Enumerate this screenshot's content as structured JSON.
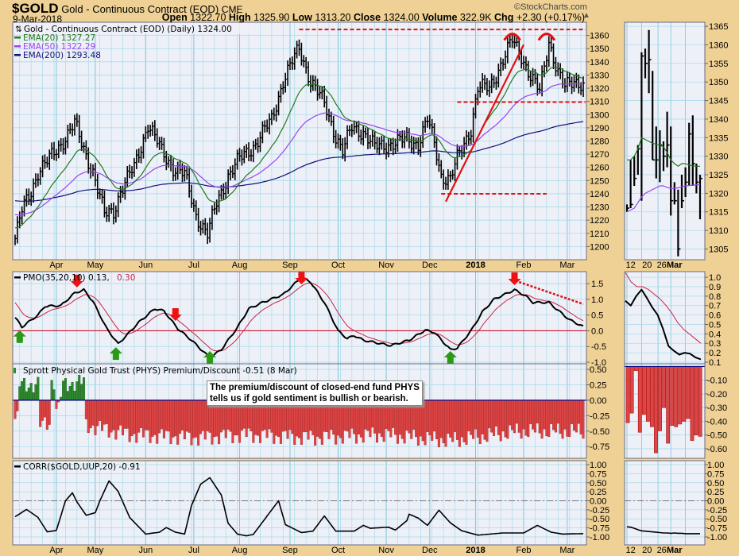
{
  "header": {
    "symbol": "$GOLD",
    "name": "Gold - Continuous Contract (EOD)",
    "exchange": "CME",
    "date": "9-Mar-2018",
    "copyright": "©StockCharts.com",
    "open_label": "Open",
    "open": "1322.70",
    "high_label": "High",
    "high": "1325.90",
    "low_label": "Low",
    "low": "1313.20",
    "close_label": "Close",
    "close": "1324.00",
    "volume_label": "Volume",
    "volume": "322.9K",
    "chg_label": "Chg",
    "chg": "+2.30 (+0.17%)"
  },
  "legend": {
    "price": "Gold - Continuous Contract (EOD) (Daily) 1324.00",
    "ema20": "EMA(20) 1327.27",
    "ema50": "EMA(50) 1322.29",
    "ema200": "EMA(200) 1293.48",
    "pmo_a": "PMO(35,20,10) 0.13,",
    "pmo_b": "0.30",
    "phys": "Sprott Physical Gold Trust (PHYS) Premium/Discount -0.51 (8 Mar)",
    "corr": "CORR($GOLD,UUP,20) -0.91"
  },
  "annotation_note": {
    "line1": "The premium/discount of closed-end fund PHYS",
    "line2": "tells us if gold sentiment is bullish or bearish."
  },
  "colors": {
    "ema20": "#1f7a1f",
    "ema50": "#9a44ee",
    "ema200": "#10107a",
    "pmo": "#000000",
    "signal": "#cc2244",
    "annotation": "#e01010",
    "phys_pos": "#2e8b2e",
    "phys_neg": "#dd4444",
    "grid": "#a9dbe9",
    "grid_major": "#7cc6dc"
  },
  "chart_data": {
    "type": "line",
    "title": "$GOLD Gold - Continuous Contract (EOD) Daily",
    "main_days": 249,
    "months": [
      [
        "Apr",
        18
      ],
      [
        "May",
        35
      ],
      [
        "Jun",
        57
      ],
      [
        "Jul",
        78
      ],
      [
        "Aug",
        98
      ],
      [
        "Sep",
        120
      ],
      [
        "Oct",
        141
      ],
      [
        "Nov",
        162
      ],
      [
        "Dec",
        181
      ],
      [
        "2018",
        201
      ],
      [
        "Feb",
        222
      ],
      [
        "Mar",
        241
      ]
    ],
    "price": {
      "ylim": [
        1190,
        1370
      ],
      "ticks": [
        "1200",
        "1210",
        "1220",
        "1230",
        "1240",
        "1250",
        "1260",
        "1270",
        "1280",
        "1290",
        "1300",
        "1310",
        "1320",
        "1330",
        "1340",
        "1350",
        "1360"
      ],
      "close_anchors": [
        [
          0,
          1206
        ],
        [
          3,
          1227
        ],
        [
          7,
          1242
        ],
        [
          10,
          1257
        ],
        [
          15,
          1266
        ],
        [
          20,
          1278
        ],
        [
          26,
          1293
        ],
        [
          29,
          1278
        ],
        [
          34,
          1257
        ],
        [
          39,
          1224
        ],
        [
          43,
          1227
        ],
        [
          46,
          1242
        ],
        [
          52,
          1260
        ],
        [
          58,
          1293
        ],
        [
          64,
          1272
        ],
        [
          69,
          1260
        ],
        [
          74,
          1254
        ],
        [
          79,
          1224
        ],
        [
          84,
          1209
        ],
        [
          88,
          1233
        ],
        [
          93,
          1254
        ],
        [
          98,
          1266
        ],
        [
          105,
          1278
        ],
        [
          112,
          1296
        ],
        [
          117,
          1326
        ],
        [
          124,
          1350
        ],
        [
          129,
          1326
        ],
        [
          135,
          1308
        ],
        [
          140,
          1284
        ],
        [
          143,
          1272
        ],
        [
          147,
          1290
        ],
        [
          152,
          1287
        ],
        [
          157,
          1275
        ],
        [
          164,
          1278
        ],
        [
          171,
          1281
        ],
        [
          176,
          1278
        ],
        [
          180,
          1296
        ],
        [
          183,
          1278
        ],
        [
          186,
          1254
        ],
        [
          190,
          1251
        ],
        [
          193,
          1266
        ],
        [
          199,
          1290
        ],
        [
          202,
          1320
        ],
        [
          207,
          1320
        ],
        [
          212,
          1338
        ],
        [
          217,
          1356
        ],
        [
          221,
          1345
        ],
        [
          225,
          1329
        ],
        [
          229,
          1317
        ],
        [
          233,
          1356
        ],
        [
          237,
          1332
        ],
        [
          240,
          1320
        ],
        [
          244,
          1326
        ],
        [
          248,
          1324
        ]
      ],
      "ema_seeds": {
        "ema20": 1215,
        "ema50": 1225,
        "ema200": 1235
      },
      "annotations": {
        "resistance": {
          "price": 1364.5,
          "from": 124,
          "to": 249
        },
        "neckline": {
          "price": 1309.5,
          "from": 193,
          "to": 249
        },
        "support": {
          "price": 1240,
          "from": 186,
          "to": 232
        },
        "trendline": [
          [
            188,
            1234
          ],
          [
            222,
            1353
          ]
        ],
        "tops": [
          [
            217,
            1360
          ],
          [
            232,
            1360
          ]
        ]
      }
    },
    "pmo": {
      "ylim": [
        -1.05,
        1.88
      ],
      "ticks": [
        "-1.0",
        "-0.5",
        "0.0",
        "0.5",
        "1.0",
        "1.5"
      ],
      "anchors": [
        [
          0,
          0.42
        ],
        [
          3,
          0.12
        ],
        [
          10,
          0.5
        ],
        [
          13,
          0.78
        ],
        [
          20,
          0.8
        ],
        [
          26,
          1.2
        ],
        [
          30,
          1.3
        ],
        [
          34,
          0.93
        ],
        [
          40,
          0.07
        ],
        [
          45,
          -0.42
        ],
        [
          49,
          -0.12
        ],
        [
          54,
          0.27
        ],
        [
          61,
          0.7
        ],
        [
          65,
          0.63
        ],
        [
          71,
          0.07
        ],
        [
          77,
          -0.3
        ],
        [
          85,
          -0.86
        ],
        [
          90,
          -0.6
        ],
        [
          97,
          0.1
        ],
        [
          102,
          0.7
        ],
        [
          108,
          0.9
        ],
        [
          117,
          1.15
        ],
        [
          125,
          1.7
        ],
        [
          129,
          1.55
        ],
        [
          135,
          0.9
        ],
        [
          141,
          0.0
        ],
        [
          145,
          -0.25
        ],
        [
          148,
          -0.15
        ],
        [
          152,
          -0.3
        ],
        [
          164,
          -0.47
        ],
        [
          172,
          -0.3
        ],
        [
          179,
          0.02
        ],
        [
          183,
          -0.05
        ],
        [
          190,
          -0.6
        ],
        [
          193,
          -0.55
        ],
        [
          199,
          0.0
        ],
        [
          204,
          0.6
        ],
        [
          209,
          1.0
        ],
        [
          218,
          1.3
        ],
        [
          223,
          1.1
        ],
        [
          226,
          0.9
        ],
        [
          233,
          0.9
        ],
        [
          237,
          0.65
        ],
        [
          242,
          0.35
        ],
        [
          248,
          0.13
        ]
      ],
      "signal_period": 10,
      "signal_seed": 1.0,
      "sell_signals": [
        27,
        70,
        125,
        218
      ],
      "buy_signals": [
        2,
        44,
        85,
        190
      ],
      "dotted_trend": [
        [
          220,
          1.55
        ],
        [
          248,
          0.85
        ]
      ]
    },
    "phys": {
      "ylim": [
        -0.94,
        0.59
      ],
      "ticks": [
        "0.50",
        "0.25",
        "0.00",
        "-0.25",
        "-0.50",
        "-0.75"
      ],
      "anchors": [
        [
          0,
          -0.3
        ],
        [
          1,
          -0.3
        ],
        [
          2,
          0.25
        ],
        [
          10,
          0.25
        ],
        [
          11,
          -0.4
        ],
        [
          15,
          -0.35
        ],
        [
          16,
          0.3
        ],
        [
          17,
          0.3
        ],
        [
          18,
          -0.15
        ],
        [
          19,
          -0.15
        ],
        [
          20,
          0.05
        ],
        [
          21,
          0.25
        ],
        [
          30,
          0.3
        ],
        [
          31,
          -0.4
        ],
        [
          50,
          -0.55
        ],
        [
          80,
          -0.6
        ],
        [
          100,
          -0.55
        ],
        [
          130,
          -0.6
        ],
        [
          160,
          -0.55
        ],
        [
          190,
          -0.65
        ],
        [
          220,
          -0.5
        ],
        [
          248,
          -0.51
        ]
      ]
    },
    "corr": {
      "ylim": [
        -1.22,
        1.11
      ],
      "ticks": [
        "1.00",
        "0.75",
        "0.50",
        "0.25",
        "0.00",
        "-0.25",
        "-0.50",
        "-0.75",
        "-1.00"
      ],
      "anchors": [
        [
          0,
          -0.44
        ],
        [
          5,
          -0.24
        ],
        [
          10,
          -0.46
        ],
        [
          14,
          -0.86
        ],
        [
          18,
          -0.82
        ],
        [
          22,
          0
        ],
        [
          25,
          0.22
        ],
        [
          27,
          -0.03
        ],
        [
          31,
          -0.4
        ],
        [
          35,
          -0.33
        ],
        [
          37,
          0
        ],
        [
          41,
          0.55
        ],
        [
          45,
          0.26
        ],
        [
          50,
          -0.46
        ],
        [
          57,
          -0.92
        ],
        [
          63,
          -0.87
        ],
        [
          66,
          -0.74
        ],
        [
          70,
          -0.87
        ],
        [
          74,
          -0.92
        ],
        [
          77,
          -0.13
        ],
        [
          81,
          0.46
        ],
        [
          85,
          0.64
        ],
        [
          90,
          0.16
        ],
        [
          93,
          -0.62
        ],
        [
          97,
          -0.92
        ],
        [
          101,
          -0.97
        ],
        [
          104,
          -0.93
        ],
        [
          110,
          -0.42
        ],
        [
          115,
          0
        ],
        [
          118,
          -0.66
        ],
        [
          125,
          -0.88
        ],
        [
          130,
          -0.84
        ],
        [
          135,
          -0.42
        ],
        [
          140,
          -0.84
        ],
        [
          148,
          -0.84
        ],
        [
          152,
          -0.68
        ],
        [
          155,
          -0.76
        ],
        [
          163,
          -0.73
        ],
        [
          166,
          -0.81
        ],
        [
          171,
          -0.55
        ],
        [
          172,
          -0.37
        ],
        [
          176,
          -0.48
        ],
        [
          180,
          -0.68
        ],
        [
          185,
          -0.26
        ],
        [
          190,
          -0.61
        ],
        [
          195,
          -0.83
        ],
        [
          202,
          -0.95
        ],
        [
          213,
          -0.89
        ],
        [
          222,
          -0.89
        ],
        [
          228,
          -0.68
        ],
        [
          234,
          -0.87
        ],
        [
          239,
          -0.92
        ],
        [
          248,
          -0.91
        ]
      ]
    },
    "side": {
      "xticks": [
        [
          "12",
          1
        ],
        [
          "20",
          5.5
        ],
        [
          "26",
          9.5
        ],
        [
          "Mar",
          13
        ]
      ],
      "price_ylim": [
        1302.1,
        1366.1
      ],
      "price_ticks": [
        "1305",
        "1310",
        "1315",
        "1320",
        "1325",
        "1330",
        "1335",
        "1340",
        "1345",
        "1350",
        "1355",
        "1360",
        "1365"
      ],
      "bars_hlc": [
        [
          1317,
          1315,
          1316
        ],
        [
          1329,
          1316,
          1317
        ],
        [
          1330,
          1322,
          1324
        ],
        [
          1333,
          1325,
          1332
        ],
        [
          1358,
          1318,
          1357
        ],
        [
          1359,
          1351,
          1355
        ],
        [
          1364,
          1347,
          1356
        ],
        [
          1353,
          1329,
          1329
        ],
        [
          1338,
          1324,
          1329
        ],
        [
          1337,
          1323,
          1333
        ],
        [
          1334,
          1326,
          1330
        ],
        [
          1342,
          1327,
          1333
        ],
        [
          1338,
          1314,
          1318
        ],
        [
          1323,
          1317,
          1318
        ],
        [
          1321,
          1303,
          1305
        ],
        [
          1325,
          1316,
          1318
        ],
        [
          1327,
          1319,
          1323
        ],
        [
          1339,
          1322,
          1336
        ],
        [
          1341,
          1322,
          1328
        ],
        [
          1328,
          1320,
          1323
        ],
        [
          1325,
          1313,
          1324
        ]
      ],
      "ema20": [
        1329,
        1329,
        1330,
        1332,
        1335,
        1334.5,
        1334,
        1333.5,
        1333.2,
        1333,
        1332.5,
        1331,
        1329,
        1328,
        1327.3,
        1328,
        1328,
        1327.6,
        1327.4,
        1327.3,
        1327.27
      ],
      "ema50": [
        1315,
        1315.5,
        1316,
        1317.5,
        1319,
        1320,
        1320.5,
        1321,
        1321.5,
        1322,
        1322,
        1321.6,
        1321.3,
        1321.3,
        1321.5,
        1321.8,
        1322,
        1322.1,
        1322.2,
        1322.3,
        1322.29
      ],
      "pmo_ylim": [
        0.083,
        1.06
      ],
      "pmo_ticks": [
        "0.1",
        "0.2",
        "0.3",
        "0.4",
        "0.5",
        "0.6",
        "0.7",
        "0.8",
        "0.9",
        "1.0"
      ],
      "pmo": [
        0.75,
        0.7,
        0.8,
        0.87,
        0.78,
        0.68,
        0.6,
        0.45,
        0.27,
        0.22,
        0.18,
        0.2,
        0.19,
        0.15,
        0.13
      ],
      "signal": [
        1.05,
        0.95,
        0.9,
        0.9,
        0.87,
        0.82,
        0.77,
        0.7,
        0.62,
        0.52,
        0.45,
        0.4,
        0.35,
        0.3
      ],
      "phys_ylim": [
        -0.67,
        0.02
      ],
      "phys_ticks": [
        "-0.10",
        "-0.20",
        "-0.30",
        "-0.40",
        "-0.50",
        "-0.60"
      ],
      "phys": [
        -0.41,
        -0.34,
        -0.03,
        -0.48,
        -0.35,
        -0.4,
        -0.44,
        -0.63,
        -0.47,
        -0.3,
        -0.56,
        -0.43,
        -0.44,
        -0.42,
        -0.4,
        -0.38,
        -0.54,
        -0.5,
        -0.51
      ],
      "corr": [
        -0.72,
        -0.73,
        -0.76,
        -0.8,
        -0.83,
        -0.84,
        -0.85,
        -0.86,
        -0.87,
        -0.88,
        -0.89,
        -0.89,
        -0.9,
        -0.89,
        -0.9,
        -0.9,
        -0.91,
        -0.91,
        -0.91,
        -0.91,
        -0.91
      ]
    }
  }
}
